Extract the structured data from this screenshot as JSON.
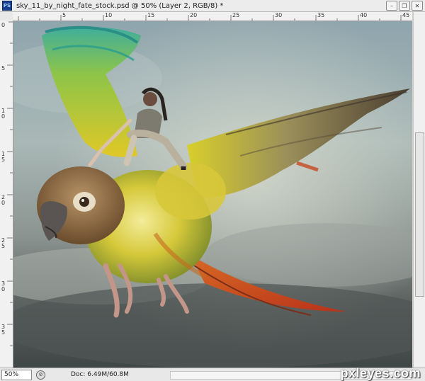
{
  "window": {
    "app_icon": "PS",
    "title": "sky_11_by_night_fate_stock.psd @ 50% (Layer 2, RGB/8) *",
    "buttons": {
      "minimize": "–",
      "restore": "❐",
      "close": "✕"
    }
  },
  "rulers": {
    "top_labels": [
      "5",
      "10",
      "15",
      "20",
      "25",
      "30",
      "35",
      "40",
      "45"
    ],
    "left_labels": [
      "0",
      "5",
      "1\n0",
      "1\n5",
      "2\n0",
      "2\n5",
      "3\n0",
      "3\n5"
    ]
  },
  "status": {
    "zoom": "50%",
    "doc_info": "Doc: 6.49M/60.8M"
  },
  "watermark": "pxleyes.com",
  "colors": {
    "sky_top": "#8fa5ad",
    "sky_bottom": "#3f4646",
    "parrot_yellow": "#d9d22a",
    "parrot_green": "#4fb59a",
    "tail_red": "#c9401d"
  }
}
